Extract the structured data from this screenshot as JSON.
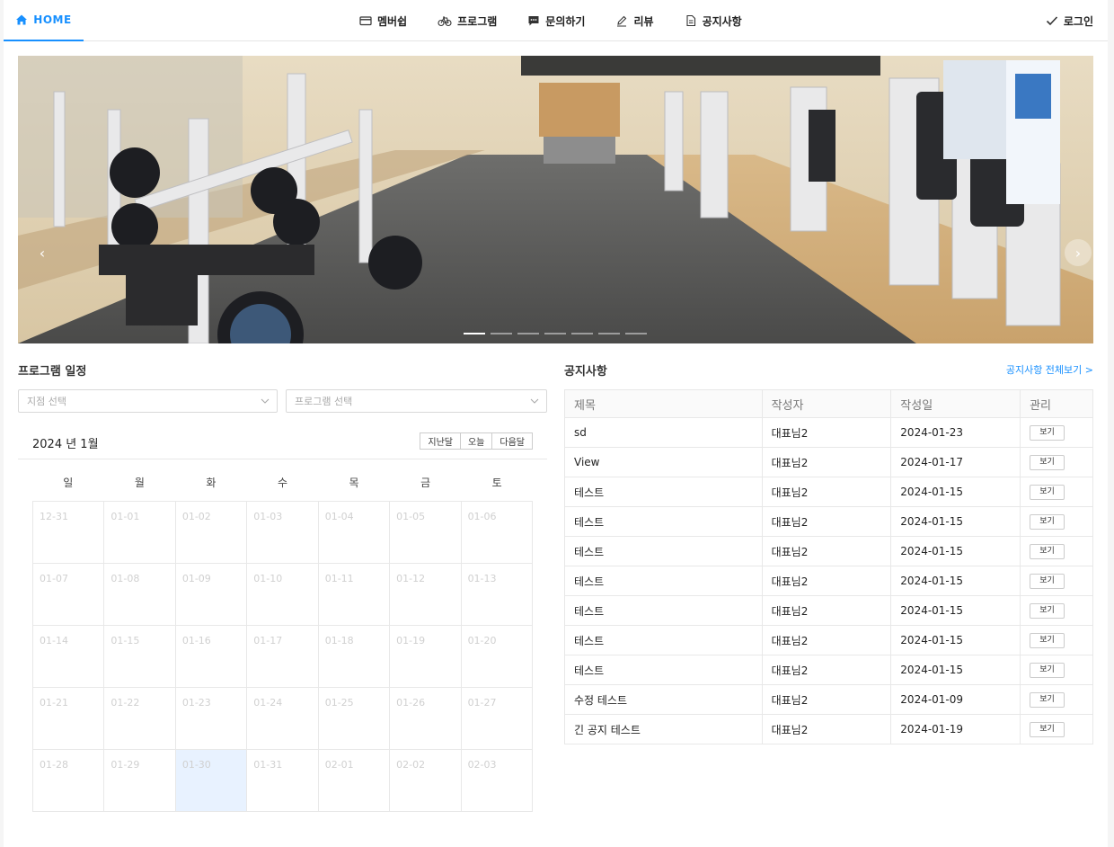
{
  "nav": {
    "home": "HOME",
    "items": [
      {
        "label": "멤버쉽",
        "icon": "card-icon"
      },
      {
        "label": "프로그램",
        "icon": "bicycle-icon"
      },
      {
        "label": "문의하기",
        "icon": "chat-icon"
      },
      {
        "label": "리뷰",
        "icon": "pen-icon"
      },
      {
        "label": "공지사항",
        "icon": "document-icon"
      }
    ],
    "login": "로그인",
    "accent": "#1890ff"
  },
  "banner": {
    "slide_count": 7,
    "active_slide": 1
  },
  "schedule": {
    "title": "프로그램 일정",
    "branch_placeholder": "지점 선택",
    "program_placeholder": "프로그램 선택",
    "calendar_title": "2024 년 1월",
    "prev_label": "지난달",
    "today_label": "오늘",
    "next_label": "다음달",
    "weekdays": [
      "일",
      "월",
      "화",
      "수",
      "목",
      "금",
      "토"
    ],
    "today": "01-30",
    "days": [
      "12-31",
      "01-01",
      "01-02",
      "01-03",
      "01-04",
      "01-05",
      "01-06",
      "01-07",
      "01-08",
      "01-09",
      "01-10",
      "01-11",
      "01-12",
      "01-13",
      "01-14",
      "01-15",
      "01-16",
      "01-17",
      "01-18",
      "01-19",
      "01-20",
      "01-21",
      "01-22",
      "01-23",
      "01-24",
      "01-25",
      "01-26",
      "01-27",
      "01-28",
      "01-29",
      "01-30",
      "01-31",
      "02-01",
      "02-02",
      "02-03"
    ]
  },
  "notices": {
    "title": "공지사항",
    "view_all": "공지사항 전체보기 >",
    "columns": [
      "제목",
      "작성자",
      "작성일",
      "관리"
    ],
    "view_label": "보기",
    "rows": [
      {
        "title": "sd",
        "author": "대표님2",
        "date": "2024-01-23"
      },
      {
        "title": "View",
        "author": "대표님2",
        "date": "2024-01-17"
      },
      {
        "title": "테스트",
        "author": "대표님2",
        "date": "2024-01-15"
      },
      {
        "title": "테스트",
        "author": "대표님2",
        "date": "2024-01-15"
      },
      {
        "title": "테스트",
        "author": "대표님2",
        "date": "2024-01-15"
      },
      {
        "title": "테스트",
        "author": "대표님2",
        "date": "2024-01-15"
      },
      {
        "title": "테스트",
        "author": "대표님2",
        "date": "2024-01-15"
      },
      {
        "title": "테스트",
        "author": "대표님2",
        "date": "2024-01-15"
      },
      {
        "title": "테스트",
        "author": "대표님2",
        "date": "2024-01-15"
      },
      {
        "title": "수정 테스트",
        "author": "대표님2",
        "date": "2024-01-09"
      },
      {
        "title": "긴 공지 테스트",
        "author": "대표님2",
        "date": "2024-01-19"
      }
    ]
  }
}
